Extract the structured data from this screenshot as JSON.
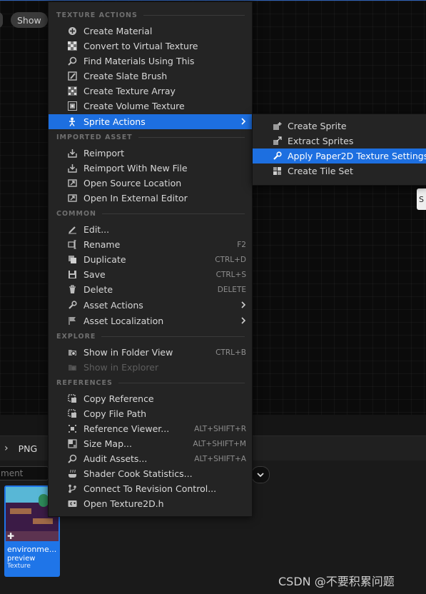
{
  "viewport": {
    "chip_left": "",
    "show_label": "Show"
  },
  "side_tab_label": "S",
  "content_browser": {
    "breadcrumb": "PNG",
    "filter_placeholder": "ment",
    "asset": {
      "name": "environme...",
      "sub": "preview",
      "type": "Texture"
    }
  },
  "context_menu": {
    "sections": {
      "texture_actions": "TEXTURE ACTIONS",
      "imported_asset": "IMPORTED ASSET",
      "common": "COMMON",
      "explore": "EXPLORE",
      "references": "REFERENCES"
    },
    "items": {
      "create_material": "Create Material",
      "convert_virtual": "Convert to Virtual Texture",
      "find_materials": "Find Materials Using This",
      "create_slate_brush": "Create Slate Brush",
      "create_texture_array": "Create Texture Array",
      "create_volume_texture": "Create Volume Texture",
      "sprite_actions": "Sprite Actions",
      "reimport": "Reimport",
      "reimport_new_file": "Reimport With New File",
      "open_source_location": "Open Source Location",
      "open_external_editor": "Open In External Editor",
      "edit": "Edit...",
      "rename": "Rename",
      "rename_sc": "F2",
      "duplicate": "Duplicate",
      "duplicate_sc": "CTRL+D",
      "save": "Save",
      "save_sc": "CTRL+S",
      "delete": "Delete",
      "delete_sc": "DELETE",
      "asset_actions": "Asset Actions",
      "asset_localization": "Asset Localization",
      "show_folder_view": "Show in Folder View",
      "show_folder_view_sc": "CTRL+B",
      "show_in_explorer": "Show in Explorer",
      "copy_reference": "Copy Reference",
      "copy_file_path": "Copy File Path",
      "reference_viewer": "Reference Viewer...",
      "reference_viewer_sc": "ALT+SHIFT+R",
      "size_map": "Size Map...",
      "size_map_sc": "ALT+SHIFT+M",
      "audit_assets": "Audit Assets...",
      "audit_assets_sc": "ALT+SHIFT+A",
      "shader_cook": "Shader Cook Statistics...",
      "connect_revision": "Connect To Revision Control...",
      "open_texture2d": "Open Texture2D.h"
    }
  },
  "sprite_submenu": {
    "create_sprite": "Create Sprite",
    "extract_sprites": "Extract Sprites",
    "apply_paper2d": "Apply Paper2D Texture Settings",
    "create_tile_set": "Create Tile Set"
  },
  "watermark": "CSDN @不要积累问题",
  "colors": {
    "highlight": "#1d6fe0",
    "menu_bg": "#242424",
    "asset_tile": "#1f75e8"
  }
}
